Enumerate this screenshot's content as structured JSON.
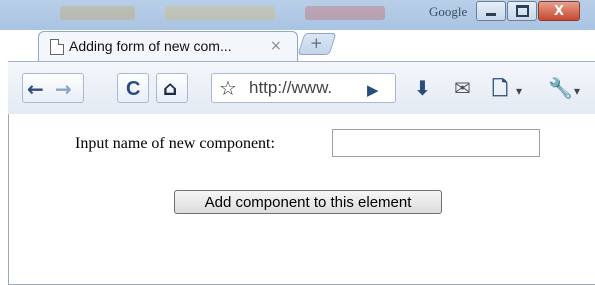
{
  "window": {
    "title_bar_label": "Google",
    "close_glyph": "X"
  },
  "tab": {
    "title": "Adding form of new com...",
    "close_glyph": "×",
    "new_tab_glyph": "+"
  },
  "toolbar": {
    "back_glyph": "←",
    "forward_glyph": "→",
    "reload_glyph": "C",
    "home_glyph": "⌂",
    "star_glyph": "☆",
    "go_glyph": "▶",
    "download_glyph": "⬇",
    "mail_glyph": "✉",
    "page_glyph": "🗋",
    "wrench_glyph": "🔧",
    "dropdown_glyph": "▾",
    "url": "http://www."
  },
  "page": {
    "input_label": "Input name of new component:",
    "input_value": "",
    "add_button_label": "Add component to this element"
  },
  "icons": {
    "tab_page": "page-icon",
    "back": "back-arrow-icon",
    "forward": "forward-arrow-icon",
    "reload": "reload-icon",
    "home": "home-icon",
    "bookmark": "star-icon",
    "go": "go-icon",
    "download": "download-icon",
    "mail": "mail-icon",
    "page_menu": "page-menu-icon",
    "tools": "wrench-icon"
  },
  "colors": {
    "frame": "#a9c3e2",
    "toolbar": "#e3eaf3",
    "icon_blue": "#2a4d7e",
    "close_red": "#c74830"
  }
}
